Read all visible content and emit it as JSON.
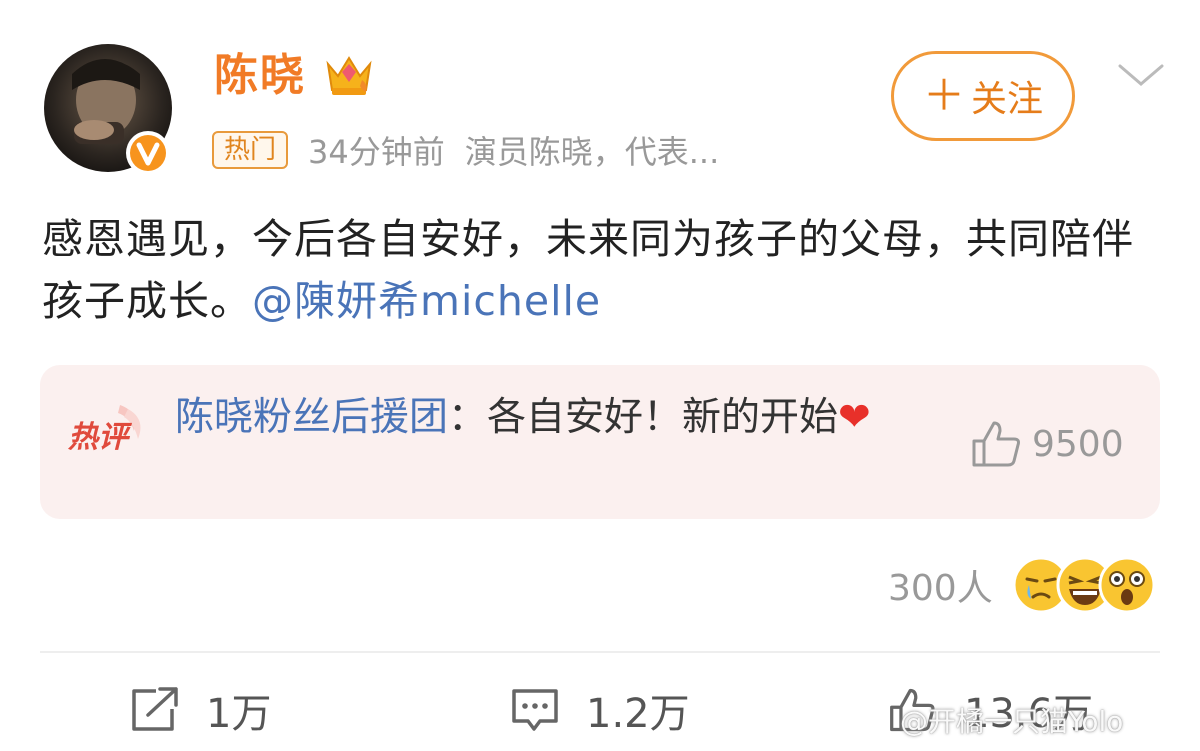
{
  "post": {
    "username": "陈晓",
    "hot_tag": "热门",
    "time": "34分钟前",
    "source": "演员陈晓，代表...",
    "follow_label": "关注",
    "text_main": "感恩遇见，今后各自安好，未来同为孩子的父母，共同陪伴孩子成长。",
    "mention": "@陳妍希michelle",
    "icons": [
      "avatar",
      "verified-badge-icon",
      "crown-icon",
      "plus-icon",
      "chevron-down-icon"
    ],
    "colors": {
      "accent": "#f17b26",
      "link": "#4a74b8"
    }
  },
  "hot_comment": {
    "badge": "热评",
    "author": "陈晓粉丝后援团",
    "separator": "：",
    "text": "各自安好！新的开始",
    "like_count": "9500"
  },
  "reactions": {
    "count": "300人"
  },
  "actions": {
    "repost": "1万",
    "comment": "1.2万",
    "like": "13.6万"
  },
  "watermark": "@开橘一只猫Yolo"
}
